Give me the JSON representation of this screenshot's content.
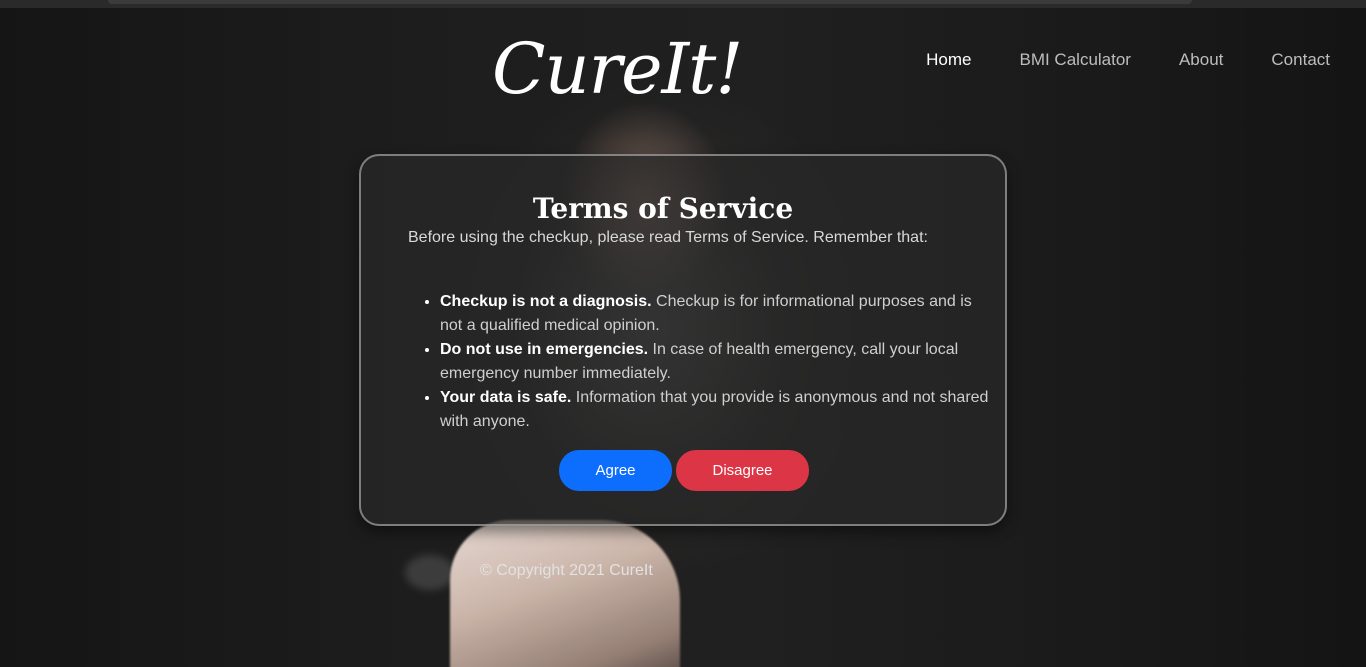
{
  "brand": {
    "logo_text": "CureIt!"
  },
  "nav": {
    "items": [
      {
        "label": "Home",
        "active": true
      },
      {
        "label": "BMI Calculator",
        "active": false
      },
      {
        "label": "About",
        "active": false
      },
      {
        "label": "Contact",
        "active": false
      }
    ]
  },
  "modal": {
    "title": "Terms of Service",
    "intro": "Before using the checkup, please read Terms of Service. Remember that:",
    "terms": [
      {
        "bold": "Checkup is not a diagnosis.",
        "text": " Checkup is for informational purposes and is not a qualified medical opinion."
      },
      {
        "bold": "Do not use in emergencies.",
        "text": " In case of health emergency, call your local emergency number immediately."
      },
      {
        "bold": "Your data is safe.",
        "text": " Information that you provide is anonymous and not shared with anyone."
      }
    ],
    "agree_label": "Agree",
    "disagree_label": "Disagree"
  },
  "footer": {
    "copyright": "© Copyright 2021 CureIt"
  },
  "colors": {
    "agree": "#0d6efd",
    "disagree": "#dc3545",
    "background": "#1b1b1b"
  }
}
